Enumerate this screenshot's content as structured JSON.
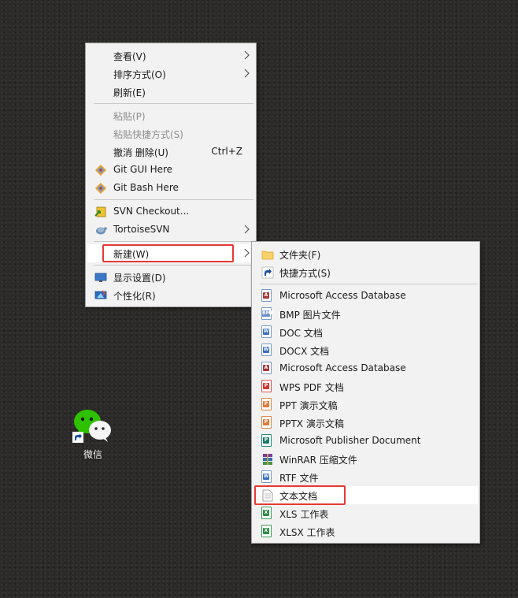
{
  "desktop": {
    "wechat_label": "微信"
  },
  "context_menu": {
    "view": "查看(V)",
    "sort": "排序方式(O)",
    "refresh": "刷新(E)",
    "paste": "粘贴(P)",
    "paste_shortcut": "粘贴快捷方式(S)",
    "undo": "撤消 删除(U)",
    "undo_shortcut": "Ctrl+Z",
    "git_gui": "Git GUI Here",
    "git_bash": "Git Bash Here",
    "svn_checkout": "SVN Checkout...",
    "tortoise_svn": "TortoiseSVN",
    "new": "新建(W)",
    "display_settings": "显示设置(D)",
    "personalize": "个性化(R)"
  },
  "new_submenu": {
    "items": [
      "文件夹(F)",
      "快捷方式(S)",
      "Microsoft Access Database",
      "BMP 图片文件",
      "DOC 文档",
      "DOCX 文档",
      "Microsoft Access Database",
      "WPS PDF 文档",
      "PPT 演示文稿",
      "PPTX 演示文稿",
      "Microsoft Publisher Document",
      "WinRAR 压缩文件",
      "RTF 文件",
      "文本文档",
      "XLS 工作表",
      "XLSX 工作表"
    ]
  },
  "colors": {
    "highlight_box": "#e53935",
    "menu_background": "#f2f2f2",
    "disabled_text": "#8d8d8d"
  }
}
